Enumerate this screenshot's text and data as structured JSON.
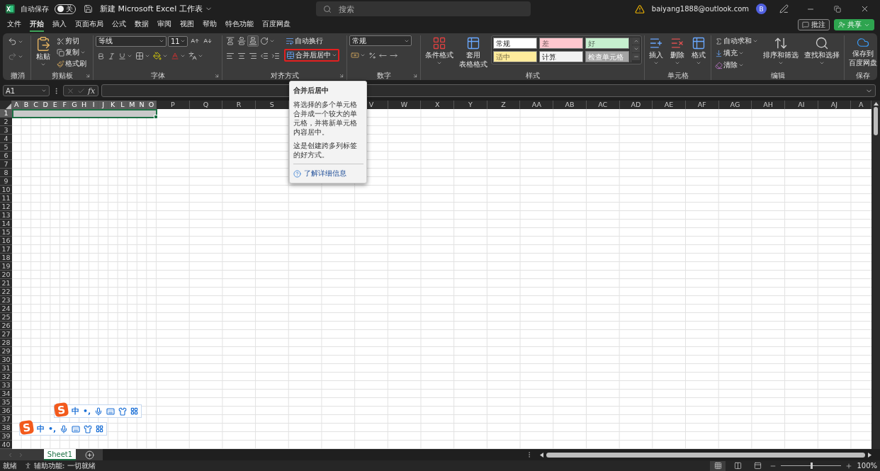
{
  "title_bar": {
    "autosave_label": "自动保存",
    "autosave": {
      "on": false,
      "label": "关"
    },
    "doc_title": "新建 Microsoft Excel 工作表",
    "search": {
      "placeholder": "搜索"
    },
    "account": "baiyang1888@outlook.com",
    "avatar": "B"
  },
  "menu_tabs": [
    {
      "label": "文件",
      "selected": false
    },
    {
      "label": "开始",
      "selected": true
    },
    {
      "label": "插入",
      "selected": false
    },
    {
      "label": "页面布局",
      "selected": false
    },
    {
      "label": "公式",
      "selected": false
    },
    {
      "label": "数据",
      "selected": false
    },
    {
      "label": "审阅",
      "selected": false
    },
    {
      "label": "视图",
      "selected": false
    },
    {
      "label": "帮助",
      "selected": false
    },
    {
      "label": "特色功能",
      "selected": false
    },
    {
      "label": "百度网盘",
      "selected": false
    }
  ],
  "comment_button": "批注",
  "share_button": "共享",
  "ribbon": {
    "undo": {
      "label": "撤消"
    },
    "clipboard": {
      "label": "剪贴板",
      "paste": "粘贴",
      "cut": "剪切",
      "copy": "复制",
      "format_painter": "格式刷"
    },
    "font": {
      "label": "字体",
      "font_name": "等线",
      "font_size": "11"
    },
    "alignment": {
      "label": "对齐方式",
      "wrap_text": "自动换行",
      "merge_center": {
        "label": "合并后居中",
        "highlighted": true
      }
    },
    "number": {
      "label": "数字",
      "format": "常规"
    },
    "styles": {
      "label": "样式",
      "conditional": "条件格式",
      "table_format": [
        "套用",
        "表格格式"
      ],
      "cell_styles": [
        {
          "label": "常规",
          "color": "#ffffff"
        },
        {
          "label": "差",
          "color": "#ffc7ce"
        },
        {
          "label": "好",
          "color": "#c6efce"
        },
        {
          "label": "适中",
          "color": "#ffeb9c"
        },
        {
          "label": "计算",
          "color": "#f2f2f2"
        },
        {
          "label": "检查单元格",
          "color": "#a5a5a5"
        }
      ]
    },
    "cells": {
      "label": "单元格",
      "insert": "插入",
      "delete": "删除",
      "format": "格式"
    },
    "editing": {
      "label": "编辑",
      "autosum": "自动求和",
      "fill": "填充",
      "clear": "清除",
      "sort_filter": "排序和筛选",
      "find_select": "查找和选择"
    },
    "save": {
      "label": "保存",
      "baidu": [
        "保存到",
        "百度网盘"
      ]
    }
  },
  "formula_bar": {
    "name_box": "A1",
    "fx": "fx"
  },
  "tooltip": {
    "title": "合并后居中",
    "paragraphs": [
      "将选择的多个单元格合并成一个较大的单元格，并将新单元格内容居中。",
      "这是创建跨多列标签的好方式。"
    ],
    "link": "了解详细信息"
  },
  "sheet": {
    "columns": [
      {
        "label": "A",
        "kind": "narrow",
        "selected": true
      },
      {
        "label": "B",
        "kind": "narrow",
        "selected": true
      },
      {
        "label": "C",
        "kind": "narrow",
        "selected": true
      },
      {
        "label": "D",
        "kind": "narrow",
        "selected": true
      },
      {
        "label": "E",
        "kind": "narrow",
        "selected": true
      },
      {
        "label": "F",
        "kind": "narrow",
        "selected": true
      },
      {
        "label": "G",
        "kind": "narrow",
        "selected": true
      },
      {
        "label": "H",
        "kind": "narrow",
        "selected": true
      },
      {
        "label": "I",
        "kind": "narrow",
        "selected": true
      },
      {
        "label": "J",
        "kind": "narrow",
        "selected": true
      },
      {
        "label": "K",
        "kind": "narrow",
        "selected": true
      },
      {
        "label": "L",
        "kind": "narrow",
        "selected": true
      },
      {
        "label": "M",
        "kind": "narrow",
        "selected": true
      },
      {
        "label": "N",
        "kind": "narrow",
        "selected": true
      },
      {
        "label": "O",
        "kind": "narrow",
        "selected": true
      },
      {
        "label": "P",
        "kind": "wide",
        "selected": false
      },
      {
        "label": "Q",
        "kind": "wide",
        "selected": false
      },
      {
        "label": "R",
        "kind": "wide",
        "selected": false
      },
      {
        "label": "S",
        "kind": "wide",
        "selected": false
      },
      {
        "kind": "wide"
      },
      {
        "kind": "wide"
      },
      {
        "label": "V",
        "kind": "wide",
        "selected": false
      },
      {
        "label": "W",
        "kind": "wide",
        "selected": false
      },
      {
        "label": "X",
        "kind": "wide",
        "selected": false
      },
      {
        "label": "Y",
        "kind": "wide",
        "selected": false
      },
      {
        "label": "Z",
        "kind": "wide",
        "selected": false
      },
      {
        "label": "AA",
        "kind": "wide",
        "selected": false
      },
      {
        "label": "AB",
        "kind": "wide",
        "selected": false
      },
      {
        "label": "AC",
        "kind": "wide",
        "selected": false
      },
      {
        "label": "AD",
        "kind": "wide",
        "selected": false
      },
      {
        "label": "AE",
        "kind": "wide",
        "selected": false
      },
      {
        "label": "AF",
        "kind": "wide",
        "selected": false
      },
      {
        "label": "AG",
        "kind": "wide",
        "selected": false
      },
      {
        "label": "AH",
        "kind": "wide",
        "selected": false
      },
      {
        "label": "AI",
        "kind": "wide",
        "selected": false
      },
      {
        "label": "AJ",
        "kind": "wide",
        "selected": false
      },
      {
        "label": "A",
        "kind": "wide",
        "selected": false
      }
    ],
    "rows": [
      {
        "label": "1",
        "selected": true
      },
      {
        "label": "2",
        "selected": false
      },
      {
        "label": "3",
        "selected": false
      },
      {
        "label": "4",
        "selected": false
      },
      {
        "label": "5",
        "selected": false
      },
      {
        "label": "6",
        "selected": false
      },
      {
        "label": "7",
        "selected": false
      },
      {
        "label": "8",
        "selected": false
      },
      {
        "label": "9",
        "selected": false
      },
      {
        "label": "10",
        "selected": false
      },
      {
        "label": "11",
        "selected": false
      },
      {
        "label": "12",
        "selected": false
      },
      {
        "label": "13",
        "selected": false
      },
      {
        "label": "14",
        "selected": false
      },
      {
        "label": "15",
        "selected": false
      },
      {
        "label": "16",
        "selected": false
      },
      {
        "label": "17",
        "selected": false
      },
      {
        "label": "18",
        "selected": false
      },
      {
        "label": "19",
        "selected": false
      },
      {
        "label": "20",
        "selected": false
      },
      {
        "label": "21",
        "selected": false
      },
      {
        "label": "22",
        "selected": false
      },
      {
        "label": "23",
        "selected": false
      },
      {
        "label": "24",
        "selected": false
      },
      {
        "label": "25",
        "selected": false
      },
      {
        "label": "26",
        "selected": false
      },
      {
        "label": "27",
        "selected": false
      },
      {
        "label": "28",
        "selected": false
      },
      {
        "label": "29",
        "selected": false
      },
      {
        "label": "30",
        "selected": false
      },
      {
        "label": "31",
        "selected": false
      },
      {
        "label": "32",
        "selected": false
      },
      {
        "label": "33",
        "selected": false
      },
      {
        "label": "34",
        "selected": false
      },
      {
        "label": "35",
        "selected": false
      },
      {
        "label": "36",
        "selected": false
      },
      {
        "label": "37",
        "selected": false
      },
      {
        "label": "38",
        "selected": false
      },
      {
        "label": "39",
        "selected": false
      },
      {
        "label": "40",
        "selected": false
      }
    ]
  },
  "ime_toolbars": [
    {
      "logo": "S",
      "mode": "中",
      "punct": "•,"
    },
    {
      "logo": "S",
      "mode": "中",
      "punct": "•,"
    }
  ],
  "sheet_tabs": [
    {
      "label": "Sheet1",
      "selected": true
    }
  ],
  "status_bar": {
    "ready": "就绪",
    "accessibility": "辅助功能: 一切就绪",
    "views": [
      {
        "selected": true
      },
      {
        "selected": false
      },
      {
        "selected": false
      }
    ],
    "zoom_slider": {
      "level": 0.5
    },
    "zoom": "100%"
  }
}
